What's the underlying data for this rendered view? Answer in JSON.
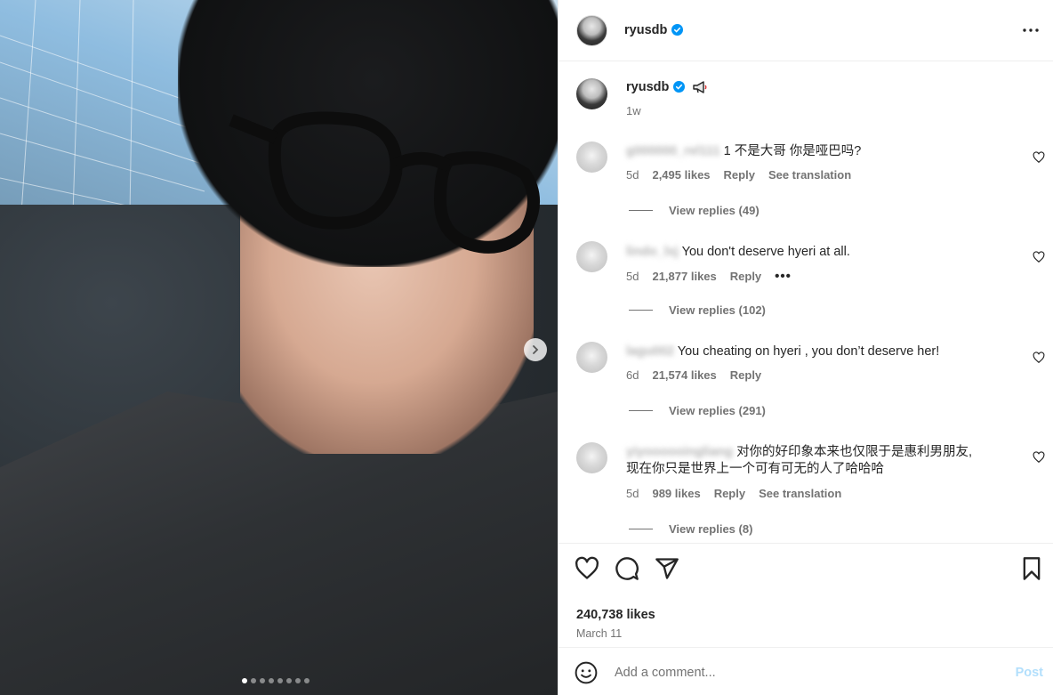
{
  "post": {
    "author": "ryusdb",
    "verified_icon": "verified-badge-icon",
    "caption_icon": "megaphone-icon",
    "caption_time": "1w",
    "carousel": {
      "slide_count": 8,
      "active_index": 0
    }
  },
  "comments": [
    {
      "username_blurred": "g000000_rel111",
      "text": "1 不是大哥 你是哑巴吗?",
      "age": "5d",
      "likes": "2,495 likes",
      "reply": "Reply",
      "translate": "See translation",
      "replies": "View replies (49)"
    },
    {
      "username_blurred": "lindo_lxj",
      "text": "You don't deserve hyeri at all.",
      "age": "5d",
      "likes": "21,877 likes",
      "reply": "Reply",
      "more": "•••",
      "replies": "View replies (102)"
    },
    {
      "username_blurred": "lagu002",
      "text": "You cheating on hyeri , you don’t deserve her!",
      "age": "6d",
      "likes": "21,574 likes",
      "reply": "Reply",
      "replies": "View replies (291)"
    },
    {
      "username_blurred": "yiyoooooingliang",
      "text_line1": "对你的好印象本来也仅限于是惠利男朋友,",
      "text_line2": "现在你只是世界上一个可有可无的人了哈哈哈",
      "age": "5d",
      "likes": "989 likes",
      "reply": "Reply",
      "translate": "See translation",
      "replies": "View replies (8)"
    }
  ],
  "actions": {
    "likes": "240,738 likes",
    "date": "March 11",
    "icons": [
      "heart-icon",
      "comment-icon",
      "share-icon",
      "bookmark-icon"
    ]
  },
  "comment_bar": {
    "placeholder": "Add a comment...",
    "post_label": "Post"
  },
  "colors": {
    "verified": "#0095f6",
    "post_disabled": "#b2dffc",
    "secondary_text": "#737373"
  }
}
